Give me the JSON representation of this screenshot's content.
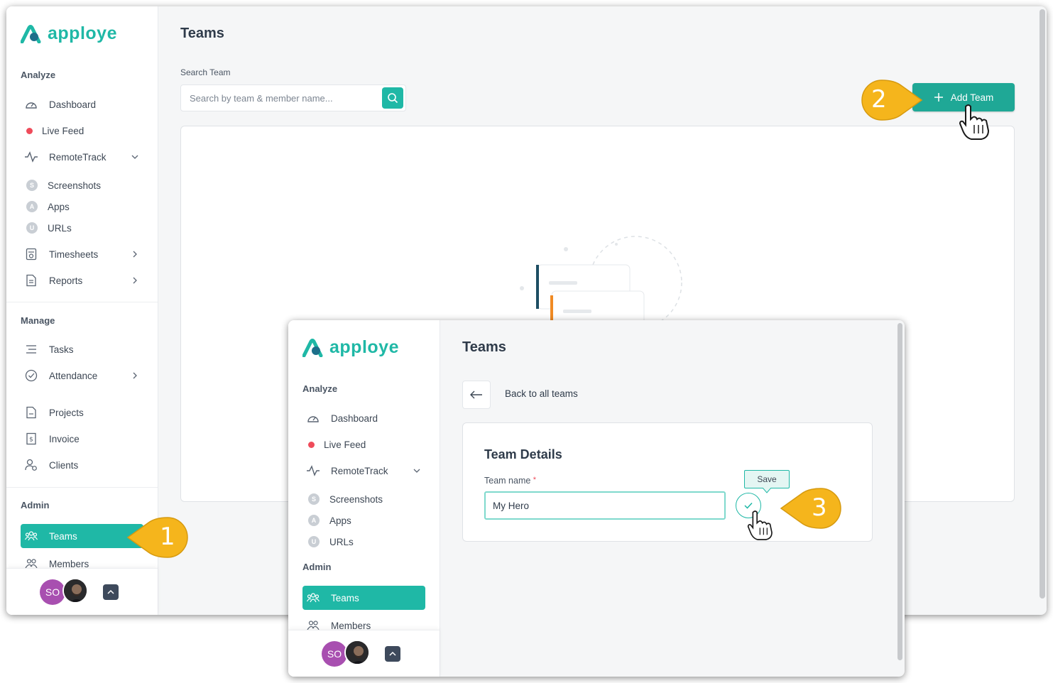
{
  "app": {
    "logo_text": "apploye",
    "brand_color": "#1fb8a6"
  },
  "sidebar": {
    "analyze_title": "Analyze",
    "manage_title": "Manage",
    "admin_title": "Admin",
    "items": {
      "dashboard": "Dashboard",
      "live_feed": "Live Feed",
      "remote_track": "RemoteTrack",
      "screenshots": "Screenshots",
      "apps": "Apps",
      "urls": "URLs",
      "timesheets": "Timesheets",
      "reports": "Reports",
      "tasks": "Tasks",
      "attendance": "Attendance",
      "projects": "Projects",
      "invoice": "Invoice",
      "clients": "Clients",
      "teams": "Teams",
      "members": "Members"
    },
    "sub_badges": {
      "screenshots": "S",
      "apps": "A",
      "urls": "U"
    },
    "footer": {
      "avatar_initials": "SO"
    }
  },
  "main1": {
    "title": "Teams",
    "search_label": "Search Team",
    "search_placeholder": "Search by team & member name...",
    "add_team_label": "Add Team"
  },
  "main2": {
    "title": "Teams",
    "back_label": "Back to all teams",
    "details_title": "Team Details",
    "team_name_label": "Team name",
    "required_mark": "*",
    "team_name_value": "My Hero",
    "save_tooltip": "Save"
  },
  "callouts": {
    "one": "1",
    "two": "2",
    "three": "3",
    "color": "#f5b51c"
  }
}
